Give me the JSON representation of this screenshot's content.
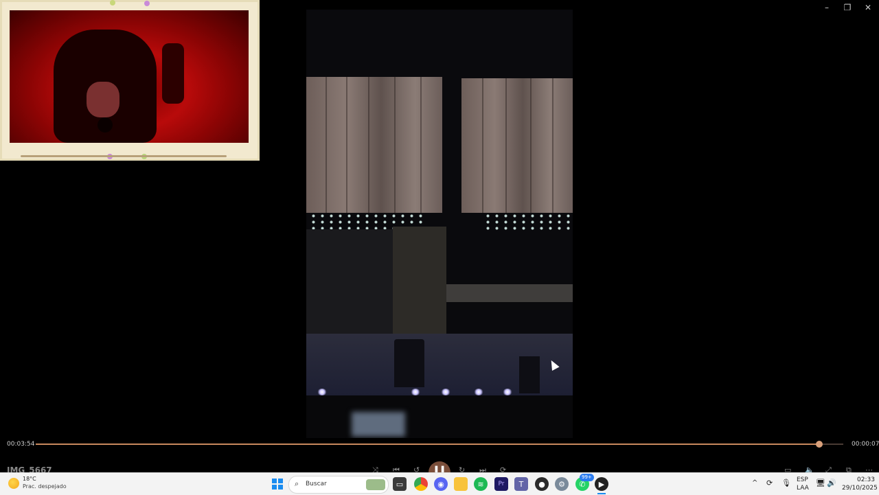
{
  "player": {
    "file_title": "IMG_5667",
    "current_time": "00:03:54",
    "remaining_time": "00:00:07",
    "progress": 0.97,
    "accent_color": "#c98a5e"
  },
  "window_controls": {
    "minimize": "–",
    "restore": "❐",
    "close": "✕"
  },
  "taskbar": {
    "weather": {
      "temp": "18°C",
      "condition": "Prac. despejado"
    },
    "search_placeholder": "Buscar",
    "apps": [
      "windows-start",
      "search",
      "file-manager",
      "chrome",
      "discord",
      "file-explorer",
      "spotify",
      "premiere",
      "teams",
      "media-app",
      "settings",
      "whatsapp",
      "media-player"
    ],
    "whatsapp_badge": "99+",
    "tray": {
      "language_top": "ESP",
      "language_bottom": "LAA",
      "time": "02:33",
      "date": "29/10/2025"
    }
  }
}
